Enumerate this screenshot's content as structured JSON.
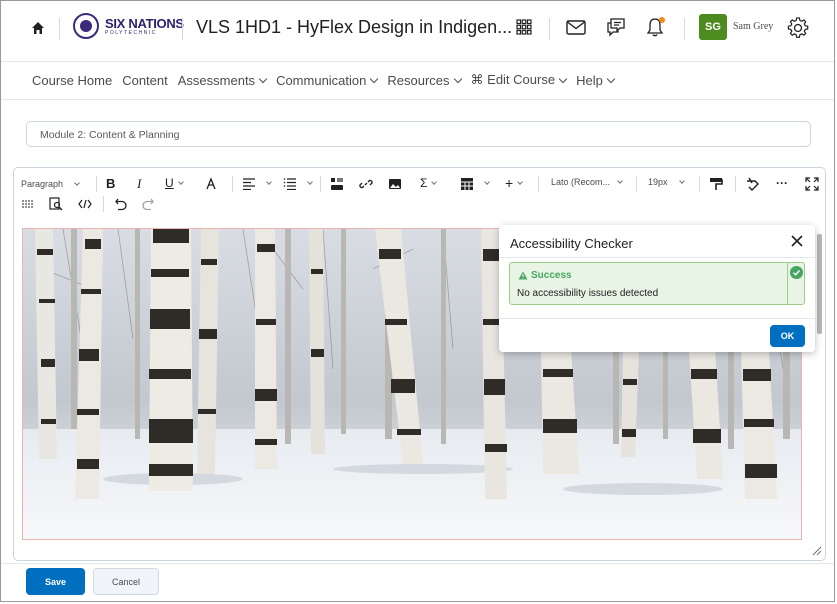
{
  "topbar": {
    "logo_text": "SIX NATIONS",
    "logo_subtext": "POLYTECHNIC",
    "course_title": "VLS 1HD1 - HyFlex Design in Indigen...",
    "user_initials": "SG",
    "user_name": "Sam Grey",
    "avatar_color": "#4d8a20",
    "notification_dot_color": "#f18b1f",
    "icons": [
      "home-icon",
      "apps-grid-icon",
      "mail-icon",
      "chat-icon",
      "bell-icon",
      "gear-icon"
    ]
  },
  "navbar": {
    "items": [
      {
        "label": "Course Home",
        "dropdown": false
      },
      {
        "label": "Content",
        "dropdown": false
      },
      {
        "label": "Assessments",
        "dropdown": true
      },
      {
        "label": "Communication",
        "dropdown": true
      },
      {
        "label": "Resources",
        "dropdown": true
      },
      {
        "label": "⌘ Edit Course",
        "dropdown": true
      },
      {
        "label": "Help",
        "dropdown": true
      }
    ]
  },
  "title_field": {
    "value": "Module 2: Content & Planning"
  },
  "toolbar": {
    "paragraph_format": "Paragraph",
    "bold": "B",
    "italic": "I",
    "underline": "U",
    "font_family": "Lato (Recom...",
    "font_size": "19px",
    "sigma": "Σ",
    "plus": "+",
    "more": "···"
  },
  "dialog": {
    "title": "Accessibility Checker",
    "alert_title": "Success",
    "alert_message": "No accessibility issues detected",
    "ok_label": "OK",
    "accent_color": "#46a661"
  },
  "footer": {
    "save_label": "Save",
    "cancel_label": "Cancel",
    "primary_color": "#006fbf"
  }
}
